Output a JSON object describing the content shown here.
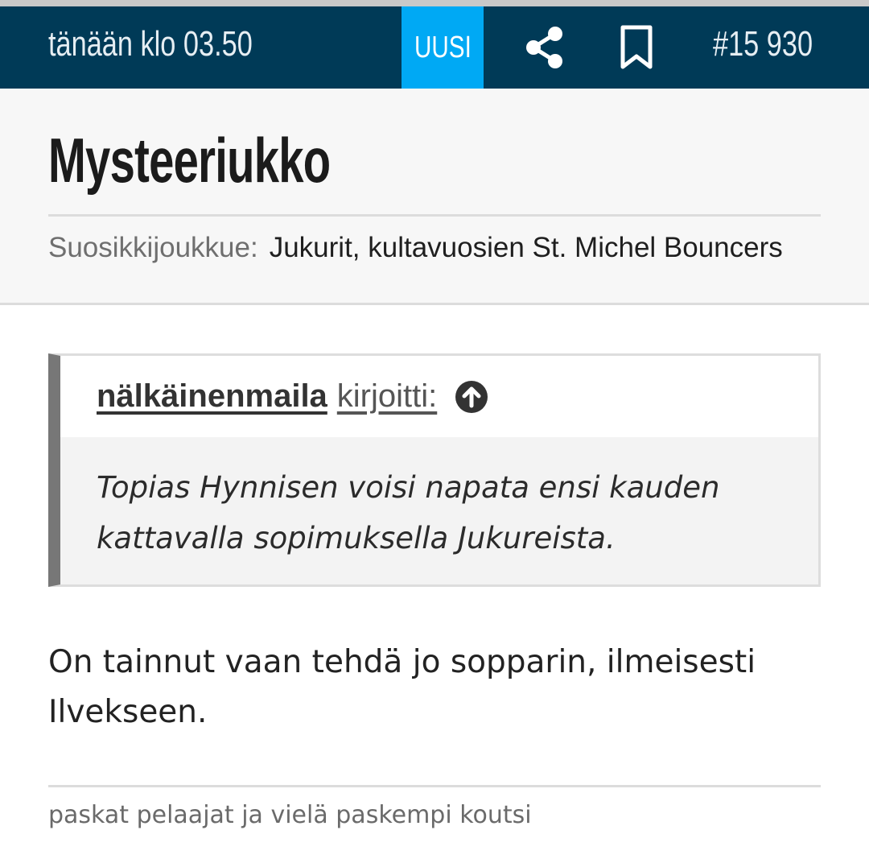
{
  "header": {
    "timestamp": "tänään klo 03.50",
    "new_badge": "UUSI",
    "share_icon": "share-icon",
    "bookmark_icon": "bookmark-icon",
    "post_number": "#15 930",
    "colors": {
      "bar": "#003a57",
      "badge": "#00a9f4"
    }
  },
  "author": {
    "username": "Mysteeriukko",
    "favorite_team_label": "Suosikkijoukkue:",
    "favorite_team_value": "Jukurit, kultavuosien St. Michel Bouncers"
  },
  "quote": {
    "author": "nälkäinenmaila",
    "wrote": "kirjoitti:",
    "jump_icon": "arrow-up-circle-icon",
    "text": "Topias Hynnisen voisi napata ensi kauden kattavalla sopimuksella Jukureista."
  },
  "post": {
    "text": "On tainnut vaan tehdä jo sopparin, ilmeisesti Ilvekseen."
  },
  "signature": "paskat pelaajat ja vielä paskempi koutsi"
}
